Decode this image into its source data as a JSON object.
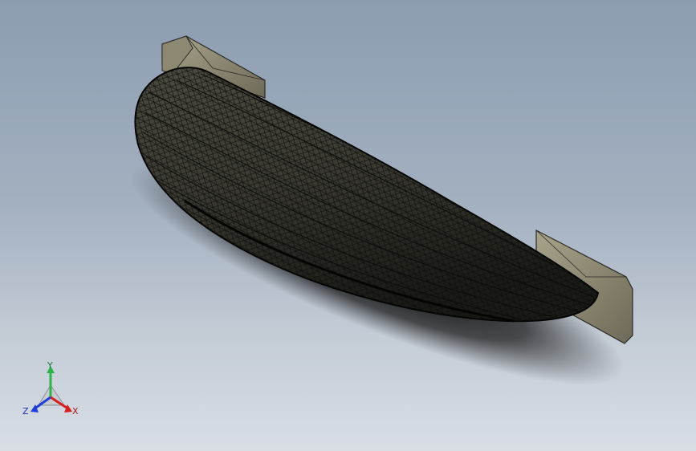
{
  "viewport": {
    "background_top": "#8c9db0",
    "background_bottom": "#d9dee5"
  },
  "model": {
    "body_color": "#3a3a33",
    "mesh_color": "#111111",
    "flange_color": "#9a967e",
    "flange_edge": "#2a2a26"
  },
  "triad": {
    "y_label": "Y",
    "x_label": "X",
    "z_label": "Z",
    "y_color": "#2db34a",
    "x_color": "#d42020",
    "z_color": "#1f3fd6"
  }
}
